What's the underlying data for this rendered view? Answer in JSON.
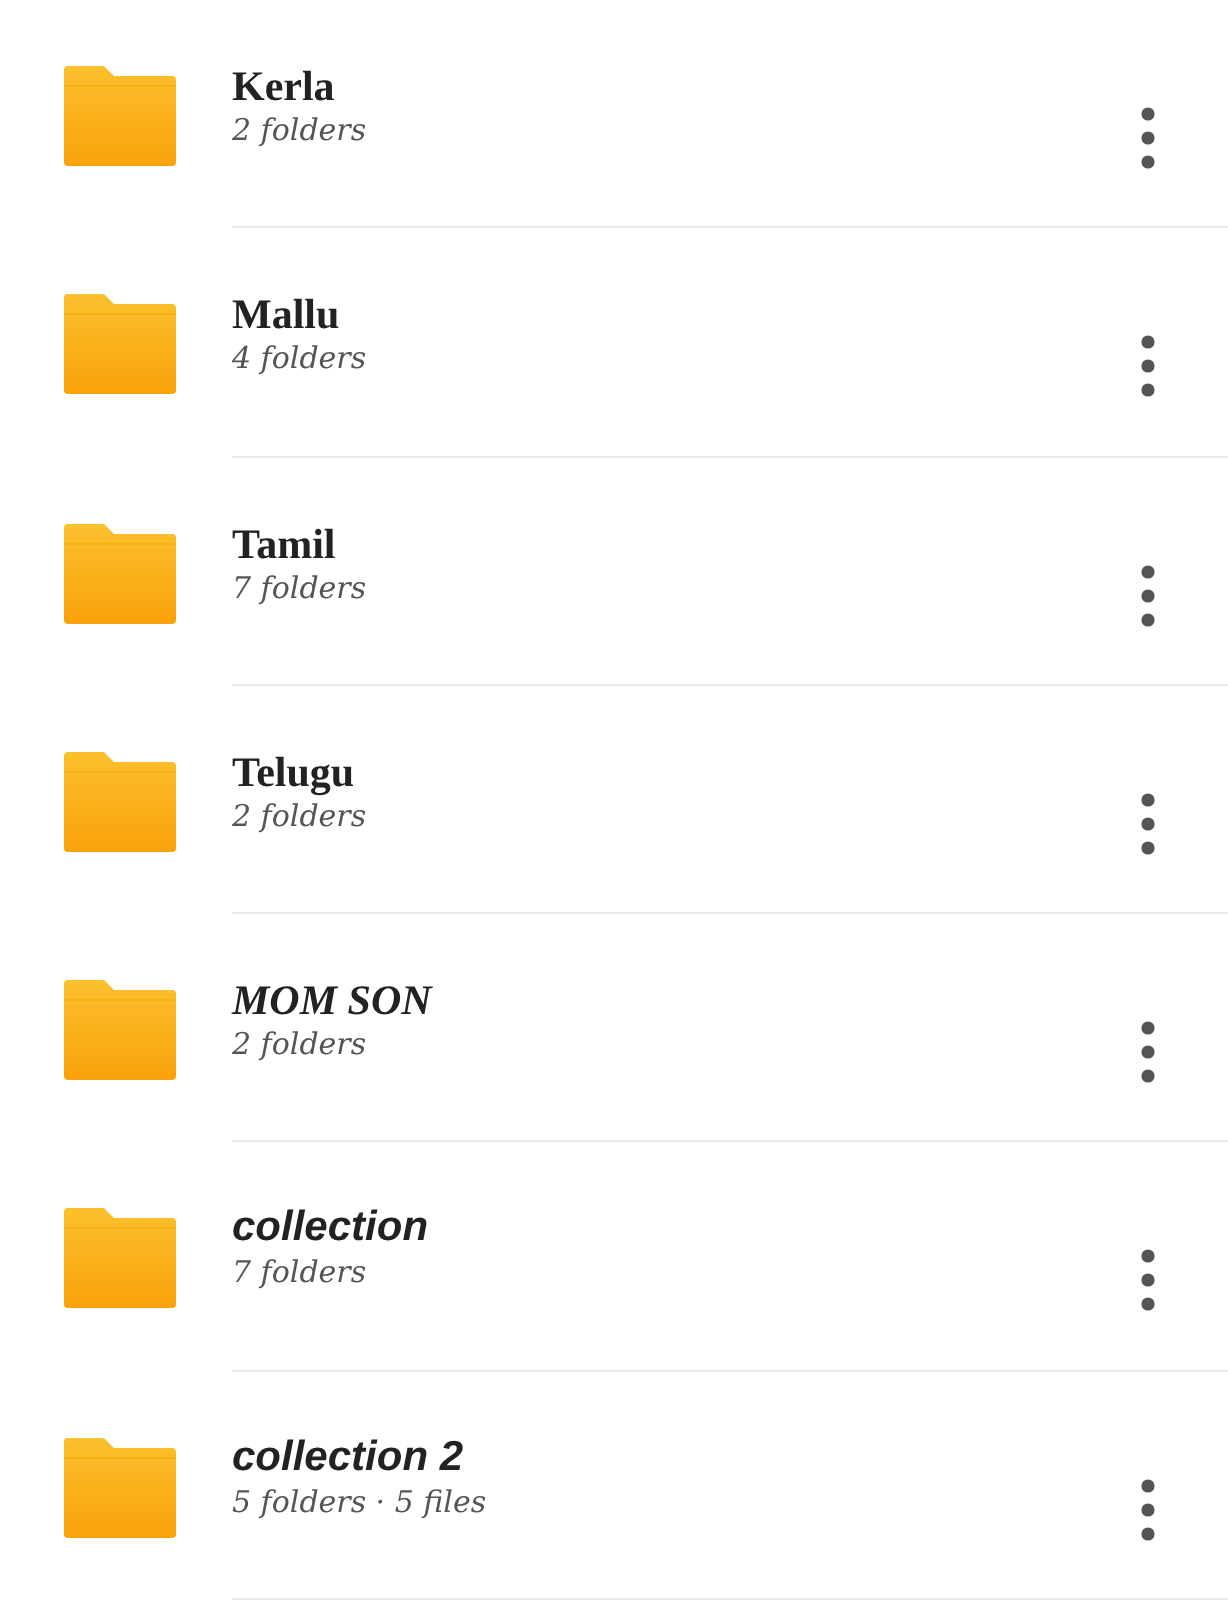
{
  "folders": [
    {
      "name": "Kerla",
      "kind": "serif",
      "details": "2 folders"
    },
    {
      "name": "Mallu",
      "kind": "serif",
      "details": "4 folders"
    },
    {
      "name": "Tamil",
      "kind": "serif",
      "details": "7 folders"
    },
    {
      "name": "Telugu",
      "kind": "serif",
      "details": "2 folders"
    },
    {
      "name": "MOM SON",
      "kind": "italic",
      "details": "2 folders"
    },
    {
      "name": "collection",
      "kind": "sans",
      "details": "7 folders"
    },
    {
      "name": "collection 2",
      "kind": "sans",
      "details": "5 folders · 5 files"
    }
  ]
}
